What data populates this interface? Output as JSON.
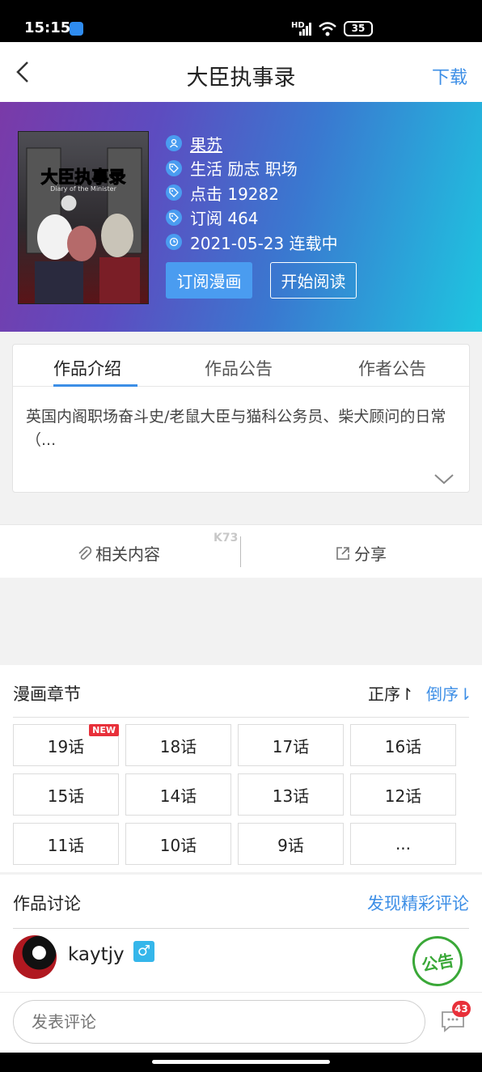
{
  "status_bar": {
    "time": "15:15",
    "network": "HD",
    "battery": "35"
  },
  "header": {
    "title": "大臣执事录",
    "download_label": "下载"
  },
  "cover": {
    "title": "大臣执事录",
    "subtitle": "Diary of the Minister"
  },
  "info": {
    "author": "果苏",
    "tags": "生活 励志 职场",
    "clicks": "点击 19282",
    "subscriptions": "订阅 464",
    "update": "2021-05-23 连载中"
  },
  "buttons": {
    "subscribe": "订阅漫画",
    "start_reading": "开始阅读"
  },
  "tabs": [
    "作品介绍",
    "作品公告",
    "作者公告"
  ],
  "active_tab": "作品介绍",
  "description": "英国内阁职场奋斗史/老鼠大臣与猫科公务员、柴犬顾问的日常\n（...",
  "actions": {
    "related": "相关内容",
    "share": "分享",
    "watermark": "K73"
  },
  "chapters": {
    "title": "漫画章节",
    "order_asc": "正序↾",
    "order_desc": "倒序⇂",
    "new_badge": "NEW",
    "items": [
      "19话",
      "18话",
      "17话",
      "16话",
      "15话",
      "14话",
      "13话",
      "12话",
      "11话",
      "10话",
      "9话",
      "..."
    ]
  },
  "discussion": {
    "title": "作品讨论",
    "link": "发现精彩评论",
    "user": "kaytjy",
    "gender_symbol": "♂",
    "stamp": "公告"
  },
  "comment": {
    "placeholder": "发表评论",
    "badge_count": "43"
  },
  "colors": {
    "accent": "#3c8ee6",
    "badge_red": "#e8303a",
    "hero_start": "#7a3aa8",
    "hero_end": "#1ec6e0"
  },
  "icons": [
    "back-arrow-icon",
    "user-icon",
    "tag-icon",
    "clock-icon",
    "chevron-down-icon",
    "attachment-icon",
    "share-icon",
    "message-icon"
  ]
}
